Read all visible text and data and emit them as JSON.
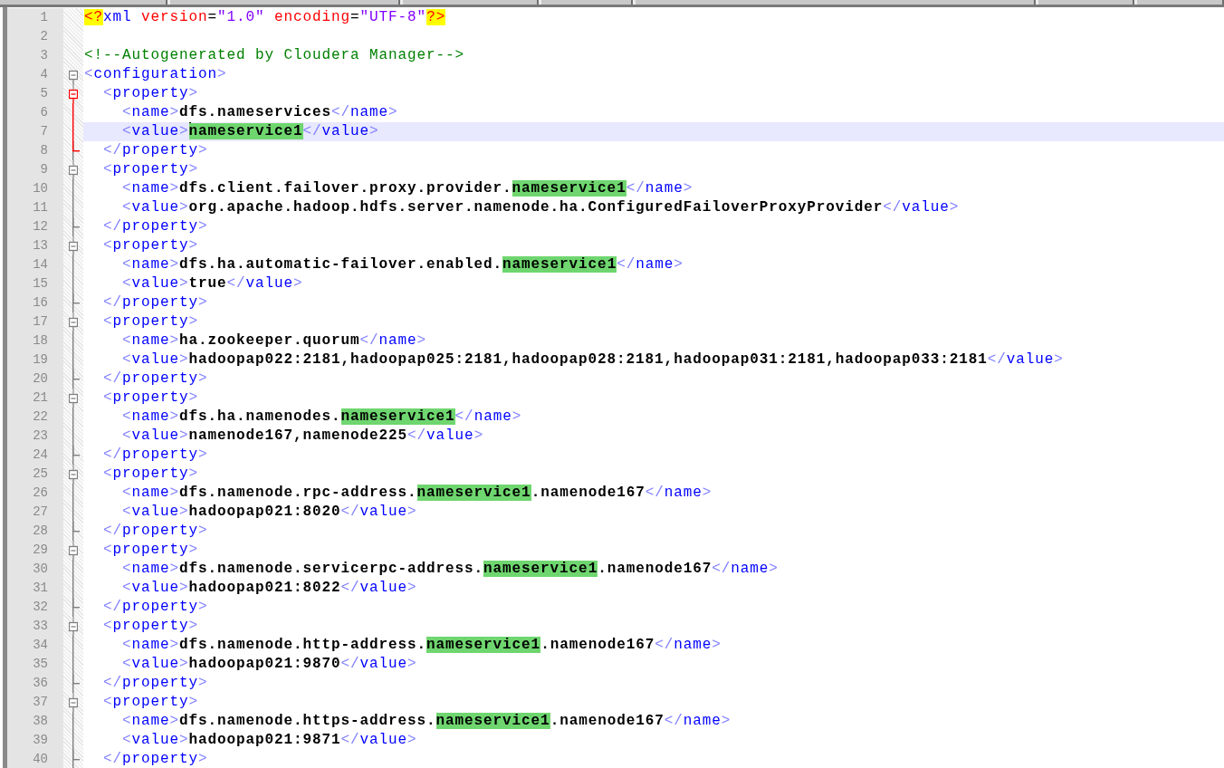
{
  "editor": {
    "lines": [
      {
        "number": "1",
        "kind": "none",
        "current": false,
        "tokens": [
          {
            "kind": "pi",
            "text": "<?"
          },
          {
            "kind": "tag",
            "text": "xml"
          },
          {
            "kind": "attr",
            "text": " version"
          },
          {
            "kind": "eq",
            "text": "="
          },
          {
            "kind": "value",
            "text": "\"1.0\""
          },
          {
            "kind": "attr",
            "text": " encoding"
          },
          {
            "kind": "eq",
            "text": "="
          },
          {
            "kind": "value",
            "text": "\"UTF-8\""
          },
          {
            "kind": "pi",
            "text": "?>"
          }
        ]
      },
      {
        "number": "2",
        "kind": "none"
      },
      {
        "number": "3",
        "kind": "none",
        "current": false,
        "tokens": [
          {
            "kind": "comment",
            "text": "<!--Autogenerated by Cloudera Manager-->"
          }
        ]
      },
      {
        "number": "4",
        "kind": "open",
        "active": false,
        "current": false,
        "tokens": [
          {
            "kind": "bracket",
            "text": "<"
          },
          {
            "kind": "tag",
            "text": "configuration"
          },
          {
            "kind": "bracket",
            "text": ">"
          }
        ]
      },
      {
        "number": "5",
        "kind": "open",
        "active": true,
        "current": false,
        "tokens": [
          {
            "kind": "bracket",
            "text": "  <"
          },
          {
            "kind": "tag",
            "text": "property"
          },
          {
            "kind": "bracket",
            "text": ">"
          }
        ]
      },
      {
        "number": "6",
        "kind": "line",
        "active": true,
        "current": false,
        "tokens": [
          {
            "kind": "bracket",
            "text": "    <"
          },
          {
            "kind": "tag",
            "text": "name"
          },
          {
            "kind": "bracket",
            "text": ">"
          },
          {
            "kind": "text",
            "text": "dfs.nameservices"
          },
          {
            "kind": "bracket",
            "text": "</"
          },
          {
            "kind": "tag",
            "text": "name"
          },
          {
            "kind": "bracket",
            "text": ">"
          }
        ]
      },
      {
        "number": "7",
        "kind": "line",
        "active": true,
        "current": true,
        "tokens": [
          {
            "kind": "bracket",
            "text": "    <"
          },
          {
            "kind": "tag",
            "text": "value"
          },
          {
            "kind": "bracket",
            "text": ">"
          },
          {
            "kind": "match",
            "text": "nameservice1",
            "caret": true
          },
          {
            "kind": "bracket",
            "text": "</"
          },
          {
            "kind": "tag",
            "text": "value"
          },
          {
            "kind": "bracket",
            "text": ">"
          }
        ]
      },
      {
        "number": "8",
        "kind": "end",
        "active": true,
        "current": false,
        "tokens": [
          {
            "kind": "bracket",
            "text": "  </"
          },
          {
            "kind": "tag",
            "text": "property"
          },
          {
            "kind": "bracket",
            "text": ">"
          }
        ]
      },
      {
        "number": "9",
        "kind": "open",
        "active": false,
        "current": false,
        "tokens": [
          {
            "kind": "bracket",
            "text": "  <"
          },
          {
            "kind": "tag",
            "text": "property"
          },
          {
            "kind": "bracket",
            "text": ">"
          }
        ]
      },
      {
        "number": "10",
        "kind": "line",
        "active": false,
        "current": false,
        "tokens": [
          {
            "kind": "bracket",
            "text": "    <"
          },
          {
            "kind": "tag",
            "text": "name"
          },
          {
            "kind": "bracket",
            "text": ">"
          },
          {
            "kind": "text",
            "text": "dfs.client.failover.proxy.provider."
          },
          {
            "kind": "match",
            "text": "nameservice1"
          },
          {
            "kind": "bracket",
            "text": "</"
          },
          {
            "kind": "tag",
            "text": "name"
          },
          {
            "kind": "bracket",
            "text": ">"
          }
        ]
      },
      {
        "number": "11",
        "kind": "line",
        "active": false,
        "current": false,
        "tokens": [
          {
            "kind": "bracket",
            "text": "    <"
          },
          {
            "kind": "tag",
            "text": "value"
          },
          {
            "kind": "bracket",
            "text": ">"
          },
          {
            "kind": "text",
            "text": "org.apache.hadoop.hdfs.server.namenode.ha.ConfiguredFailoverProxyProvider"
          },
          {
            "kind": "bracket",
            "text": "</"
          },
          {
            "kind": "tag",
            "text": "value"
          },
          {
            "kind": "bracket",
            "text": ">"
          }
        ]
      },
      {
        "number": "12",
        "kind": "end",
        "active": false,
        "current": false,
        "tokens": [
          {
            "kind": "bracket",
            "text": "  </"
          },
          {
            "kind": "tag",
            "text": "property"
          },
          {
            "kind": "bracket",
            "text": ">"
          }
        ]
      },
      {
        "number": "13",
        "kind": "open",
        "active": false,
        "current": false,
        "tokens": [
          {
            "kind": "bracket",
            "text": "  <"
          },
          {
            "kind": "tag",
            "text": "property"
          },
          {
            "kind": "bracket",
            "text": ">"
          }
        ]
      },
      {
        "number": "14",
        "kind": "line",
        "active": false,
        "current": false,
        "tokens": [
          {
            "kind": "bracket",
            "text": "    <"
          },
          {
            "kind": "tag",
            "text": "name"
          },
          {
            "kind": "bracket",
            "text": ">"
          },
          {
            "kind": "text",
            "text": "dfs.ha.automatic-failover.enabled."
          },
          {
            "kind": "match",
            "text": "nameservice1"
          },
          {
            "kind": "bracket",
            "text": "</"
          },
          {
            "kind": "tag",
            "text": "name"
          },
          {
            "kind": "bracket",
            "text": ">"
          }
        ]
      },
      {
        "number": "15",
        "kind": "line",
        "active": false,
        "current": false,
        "tokens": [
          {
            "kind": "bracket",
            "text": "    <"
          },
          {
            "kind": "tag",
            "text": "value"
          },
          {
            "kind": "bracket",
            "text": ">"
          },
          {
            "kind": "text",
            "text": "true"
          },
          {
            "kind": "bracket",
            "text": "</"
          },
          {
            "kind": "tag",
            "text": "value"
          },
          {
            "kind": "bracket",
            "text": ">"
          }
        ]
      },
      {
        "number": "16",
        "kind": "end",
        "active": false,
        "current": false,
        "tokens": [
          {
            "kind": "bracket",
            "text": "  </"
          },
          {
            "kind": "tag",
            "text": "property"
          },
          {
            "kind": "bracket",
            "text": ">"
          }
        ]
      },
      {
        "number": "17",
        "kind": "open",
        "active": false,
        "current": false,
        "tokens": [
          {
            "kind": "bracket",
            "text": "  <"
          },
          {
            "kind": "tag",
            "text": "property"
          },
          {
            "kind": "bracket",
            "text": ">"
          }
        ]
      },
      {
        "number": "18",
        "kind": "line",
        "active": false,
        "current": false,
        "tokens": [
          {
            "kind": "bracket",
            "text": "    <"
          },
          {
            "kind": "tag",
            "text": "name"
          },
          {
            "kind": "bracket",
            "text": ">"
          },
          {
            "kind": "text",
            "text": "ha.zookeeper.quorum"
          },
          {
            "kind": "bracket",
            "text": "</"
          },
          {
            "kind": "tag",
            "text": "name"
          },
          {
            "kind": "bracket",
            "text": ">"
          }
        ]
      },
      {
        "number": "19",
        "kind": "line",
        "active": false,
        "current": false,
        "tokens": [
          {
            "kind": "bracket",
            "text": "    <"
          },
          {
            "kind": "tag",
            "text": "value"
          },
          {
            "kind": "bracket",
            "text": ">"
          },
          {
            "kind": "text",
            "text": "hadoopap022:2181,hadoopap025:2181,hadoopap028:2181,hadoopap031:2181,hadoopap033:2181"
          },
          {
            "kind": "bracket",
            "text": "</"
          },
          {
            "kind": "tag",
            "text": "value"
          },
          {
            "kind": "bracket",
            "text": ">"
          }
        ]
      },
      {
        "number": "20",
        "kind": "end",
        "active": false,
        "current": false,
        "tokens": [
          {
            "kind": "bracket",
            "text": "  </"
          },
          {
            "kind": "tag",
            "text": "property"
          },
          {
            "kind": "bracket",
            "text": ">"
          }
        ]
      },
      {
        "number": "21",
        "kind": "open",
        "active": false,
        "current": false,
        "tokens": [
          {
            "kind": "bracket",
            "text": "  <"
          },
          {
            "kind": "tag",
            "text": "property"
          },
          {
            "kind": "bracket",
            "text": ">"
          }
        ]
      },
      {
        "number": "22",
        "kind": "line",
        "active": false,
        "current": false,
        "tokens": [
          {
            "kind": "bracket",
            "text": "    <"
          },
          {
            "kind": "tag",
            "text": "name"
          },
          {
            "kind": "bracket",
            "text": ">"
          },
          {
            "kind": "text",
            "text": "dfs.ha.namenodes."
          },
          {
            "kind": "match",
            "text": "nameservice1"
          },
          {
            "kind": "bracket",
            "text": "</"
          },
          {
            "kind": "tag",
            "text": "name"
          },
          {
            "kind": "bracket",
            "text": ">"
          }
        ]
      },
      {
        "number": "23",
        "kind": "line",
        "active": false,
        "current": false,
        "tokens": [
          {
            "kind": "bracket",
            "text": "    <"
          },
          {
            "kind": "tag",
            "text": "value"
          },
          {
            "kind": "bracket",
            "text": ">"
          },
          {
            "kind": "text",
            "text": "namenode167,namenode225"
          },
          {
            "kind": "bracket",
            "text": "</"
          },
          {
            "kind": "tag",
            "text": "value"
          },
          {
            "kind": "bracket",
            "text": ">"
          }
        ]
      },
      {
        "number": "24",
        "kind": "end",
        "active": false,
        "current": false,
        "tokens": [
          {
            "kind": "bracket",
            "text": "  </"
          },
          {
            "kind": "tag",
            "text": "property"
          },
          {
            "kind": "bracket",
            "text": ">"
          }
        ]
      },
      {
        "number": "25",
        "kind": "open",
        "active": false,
        "current": false,
        "tokens": [
          {
            "kind": "bracket",
            "text": "  <"
          },
          {
            "kind": "tag",
            "text": "property"
          },
          {
            "kind": "bracket",
            "text": ">"
          }
        ]
      },
      {
        "number": "26",
        "kind": "line",
        "active": false,
        "current": false,
        "tokens": [
          {
            "kind": "bracket",
            "text": "    <"
          },
          {
            "kind": "tag",
            "text": "name"
          },
          {
            "kind": "bracket",
            "text": ">"
          },
          {
            "kind": "text",
            "text": "dfs.namenode.rpc-address."
          },
          {
            "kind": "match",
            "text": "nameservice1"
          },
          {
            "kind": "text",
            "text": ".namenode167"
          },
          {
            "kind": "bracket",
            "text": "</"
          },
          {
            "kind": "tag",
            "text": "name"
          },
          {
            "kind": "bracket",
            "text": ">"
          }
        ]
      },
      {
        "number": "27",
        "kind": "line",
        "active": false,
        "current": false,
        "tokens": [
          {
            "kind": "bracket",
            "text": "    <"
          },
          {
            "kind": "tag",
            "text": "value"
          },
          {
            "kind": "bracket",
            "text": ">"
          },
          {
            "kind": "text",
            "text": "hadoopap021:8020"
          },
          {
            "kind": "bracket",
            "text": "</"
          },
          {
            "kind": "tag",
            "text": "value"
          },
          {
            "kind": "bracket",
            "text": ">"
          }
        ]
      },
      {
        "number": "28",
        "kind": "end",
        "active": false,
        "current": false,
        "tokens": [
          {
            "kind": "bracket",
            "text": "  </"
          },
          {
            "kind": "tag",
            "text": "property"
          },
          {
            "kind": "bracket",
            "text": ">"
          }
        ]
      },
      {
        "number": "29",
        "kind": "open",
        "active": false,
        "current": false,
        "tokens": [
          {
            "kind": "bracket",
            "text": "  <"
          },
          {
            "kind": "tag",
            "text": "property"
          },
          {
            "kind": "bracket",
            "text": ">"
          }
        ]
      },
      {
        "number": "30",
        "kind": "line",
        "active": false,
        "current": false,
        "tokens": [
          {
            "kind": "bracket",
            "text": "    <"
          },
          {
            "kind": "tag",
            "text": "name"
          },
          {
            "kind": "bracket",
            "text": ">"
          },
          {
            "kind": "text",
            "text": "dfs.namenode.servicerpc-address."
          },
          {
            "kind": "match",
            "text": "nameservice1"
          },
          {
            "kind": "text",
            "text": ".namenode167"
          },
          {
            "kind": "bracket",
            "text": "</"
          },
          {
            "kind": "tag",
            "text": "name"
          },
          {
            "kind": "bracket",
            "text": ">"
          }
        ]
      },
      {
        "number": "31",
        "kind": "line",
        "active": false,
        "current": false,
        "tokens": [
          {
            "kind": "bracket",
            "text": "    <"
          },
          {
            "kind": "tag",
            "text": "value"
          },
          {
            "kind": "bracket",
            "text": ">"
          },
          {
            "kind": "text",
            "text": "hadoopap021:8022"
          },
          {
            "kind": "bracket",
            "text": "</"
          },
          {
            "kind": "tag",
            "text": "value"
          },
          {
            "kind": "bracket",
            "text": ">"
          }
        ]
      },
      {
        "number": "32",
        "kind": "end",
        "active": false,
        "current": false,
        "tokens": [
          {
            "kind": "bracket",
            "text": "  </"
          },
          {
            "kind": "tag",
            "text": "property"
          },
          {
            "kind": "bracket",
            "text": ">"
          }
        ]
      },
      {
        "number": "33",
        "kind": "open",
        "active": false,
        "current": false,
        "tokens": [
          {
            "kind": "bracket",
            "text": "  <"
          },
          {
            "kind": "tag",
            "text": "property"
          },
          {
            "kind": "bracket",
            "text": ">"
          }
        ]
      },
      {
        "number": "34",
        "kind": "line",
        "active": false,
        "current": false,
        "tokens": [
          {
            "kind": "bracket",
            "text": "    <"
          },
          {
            "kind": "tag",
            "text": "name"
          },
          {
            "kind": "bracket",
            "text": ">"
          },
          {
            "kind": "text",
            "text": "dfs.namenode.http-address."
          },
          {
            "kind": "match",
            "text": "nameservice1"
          },
          {
            "kind": "text",
            "text": ".namenode167"
          },
          {
            "kind": "bracket",
            "text": "</"
          },
          {
            "kind": "tag",
            "text": "name"
          },
          {
            "kind": "bracket",
            "text": ">"
          }
        ]
      },
      {
        "number": "35",
        "kind": "line",
        "active": false,
        "current": false,
        "tokens": [
          {
            "kind": "bracket",
            "text": "    <"
          },
          {
            "kind": "tag",
            "text": "value"
          },
          {
            "kind": "bracket",
            "text": ">"
          },
          {
            "kind": "text",
            "text": "hadoopap021:9870"
          },
          {
            "kind": "bracket",
            "text": "</"
          },
          {
            "kind": "tag",
            "text": "value"
          },
          {
            "kind": "bracket",
            "text": ">"
          }
        ]
      },
      {
        "number": "36",
        "kind": "end",
        "active": false,
        "current": false,
        "tokens": [
          {
            "kind": "bracket",
            "text": "  </"
          },
          {
            "kind": "tag",
            "text": "property"
          },
          {
            "kind": "bracket",
            "text": ">"
          }
        ]
      },
      {
        "number": "37",
        "kind": "open",
        "active": false,
        "current": false,
        "tokens": [
          {
            "kind": "bracket",
            "text": "  <"
          },
          {
            "kind": "tag",
            "text": "property"
          },
          {
            "kind": "bracket",
            "text": ">"
          }
        ]
      },
      {
        "number": "38",
        "kind": "line",
        "active": false,
        "current": false,
        "tokens": [
          {
            "kind": "bracket",
            "text": "    <"
          },
          {
            "kind": "tag",
            "text": "name"
          },
          {
            "kind": "bracket",
            "text": ">"
          },
          {
            "kind": "text",
            "text": "dfs.namenode.https-address."
          },
          {
            "kind": "match",
            "text": "nameservice1"
          },
          {
            "kind": "text",
            "text": ".namenode167"
          },
          {
            "kind": "bracket",
            "text": "</"
          },
          {
            "kind": "tag",
            "text": "name"
          },
          {
            "kind": "bracket",
            "text": ">"
          }
        ]
      },
      {
        "number": "39",
        "kind": "line",
        "active": false,
        "current": false,
        "tokens": [
          {
            "kind": "bracket",
            "text": "    <"
          },
          {
            "kind": "tag",
            "text": "value"
          },
          {
            "kind": "bracket",
            "text": ">"
          },
          {
            "kind": "text",
            "text": "hadoopap021:9871"
          },
          {
            "kind": "bracket",
            "text": "</"
          },
          {
            "kind": "tag",
            "text": "value"
          },
          {
            "kind": "bracket",
            "text": ">"
          }
        ]
      },
      {
        "number": "40",
        "kind": "end",
        "active": false,
        "current": false,
        "tokens": [
          {
            "kind": "bracket",
            "text": "  </"
          },
          {
            "kind": "tag",
            "text": "property"
          },
          {
            "kind": "bracket",
            "text": ">"
          }
        ]
      }
    ]
  }
}
